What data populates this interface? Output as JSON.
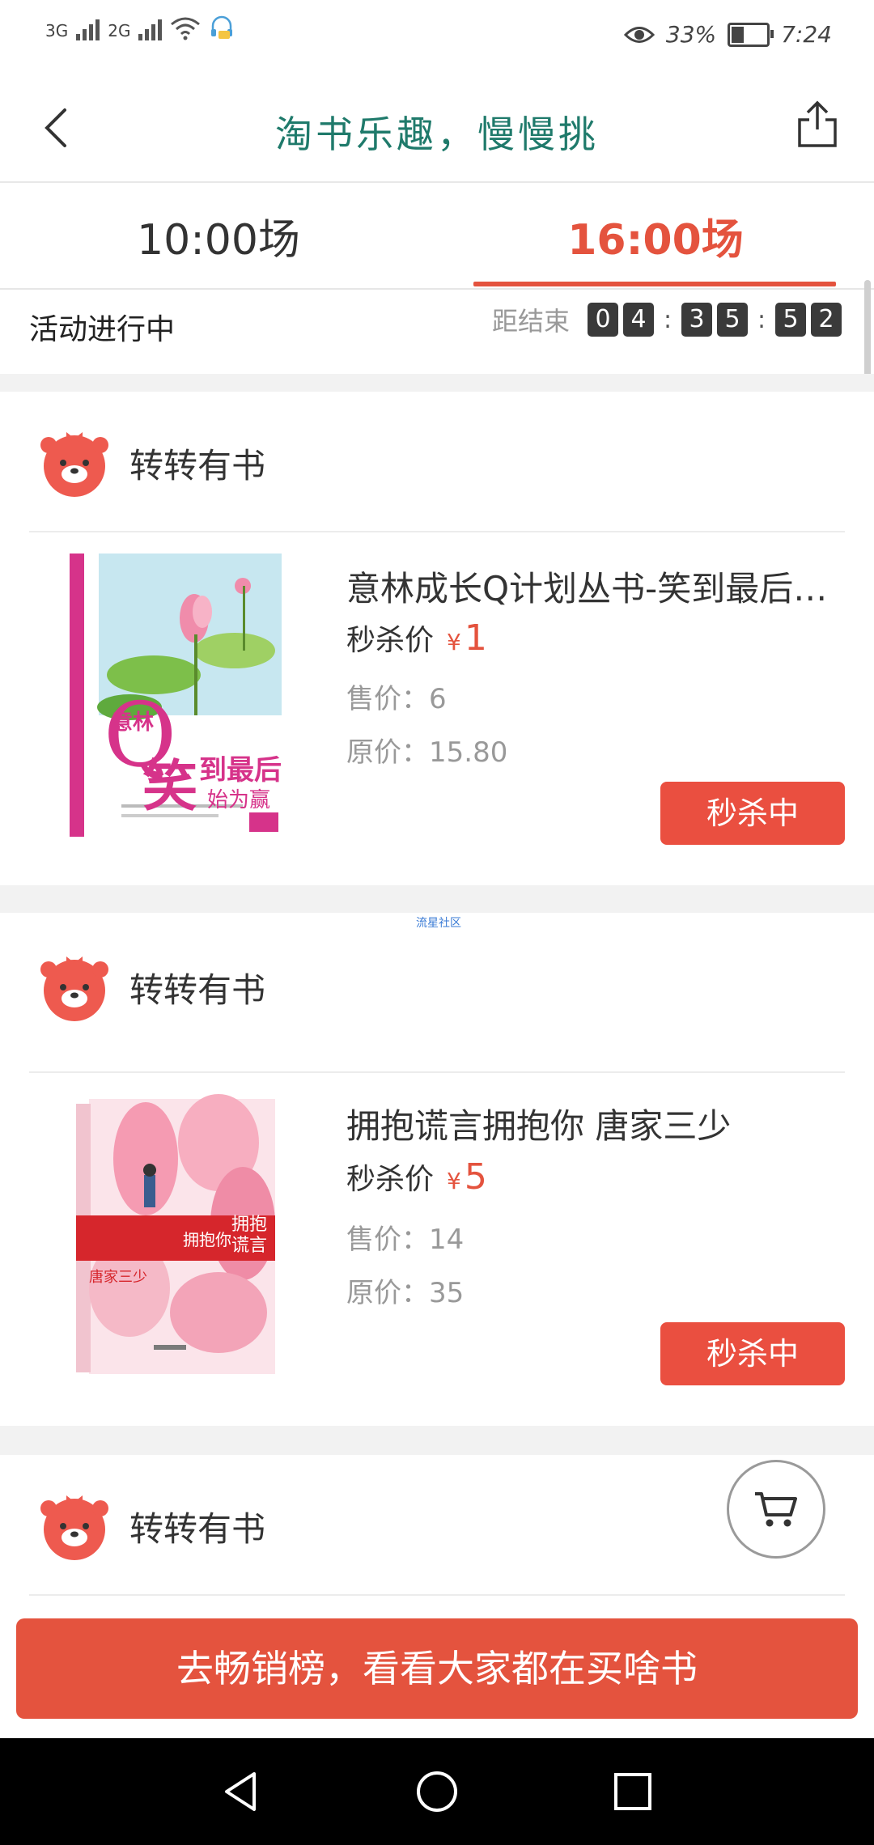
{
  "status_bar": {
    "network1": "3G",
    "network2": "2G",
    "battery_pct": "33%",
    "time": "7:24",
    "battery_level": 0.33
  },
  "header": {
    "title": "淘书乐趣，慢慢挑",
    "back_icon": "back-arrow-icon",
    "share_icon": "share-icon"
  },
  "tabs": [
    {
      "label": "10:00场",
      "active": false
    },
    {
      "label": "16:00场",
      "active": true
    }
  ],
  "activity": {
    "status": "活动进行中",
    "countdown_label": "距结束",
    "countdown": {
      "h1": "0",
      "h2": "4",
      "m1": "3",
      "m2": "5",
      "s1": "5",
      "s2": "2"
    },
    "separator": ":"
  },
  "products": [
    {
      "shop_name": "转转有书",
      "title": "意林成长Q计划丛书-笑到最后始为赢",
      "seckill_label": "秒杀价",
      "currency": "¥",
      "seckill_price": "1",
      "sale_price": "售价：6",
      "original_price": "原价：15.80",
      "button": "秒杀中",
      "cover_text": {
        "brand": "意林",
        "q": "Q",
        "big": "笑",
        "rest": "到最后",
        "sub": "始为赢"
      }
    },
    {
      "shop_name": "转转有书",
      "title": "拥抱谎言拥抱你 唐家三少",
      "seckill_label": "秒杀价",
      "currency": "¥",
      "seckill_price": "5",
      "sale_price": "售价：14",
      "original_price": "原价：35",
      "button": "秒杀中",
      "cover_text": {
        "t1": "拥抱",
        "t2": "谎言",
        "t3": "拥抱你",
        "author": "唐家三少"
      }
    },
    {
      "shop_name": "转转有书"
    }
  ],
  "watermark": "流星社区",
  "cart_icon": "cart-icon",
  "banner": "去畅销榜，看看大家都在买啥书",
  "colors": {
    "accent": "#e4533e",
    "title_green": "#1f7a6b"
  }
}
